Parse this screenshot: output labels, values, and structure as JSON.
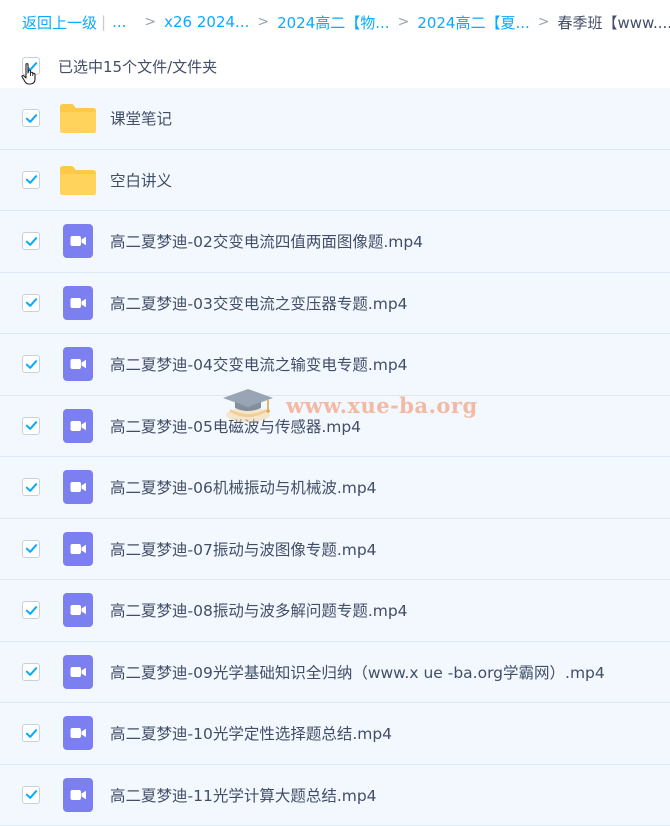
{
  "breadcrumb": {
    "back": "返回上一级",
    "ellipsis": "...",
    "items": [
      "x26 2024...",
      "2024高二【物...",
      "2024高二【夏...",
      "春季班【www...."
    ]
  },
  "selection": {
    "count_label": "已选中15个文件/文件夹"
  },
  "files": [
    {
      "name": "课堂笔记",
      "type": "folder"
    },
    {
      "name": "空白讲义",
      "type": "folder"
    },
    {
      "name": "高二夏梦迪-02交变电流四值两面图像题.mp4",
      "type": "video"
    },
    {
      "name": "高二夏梦迪-03交变电流之变压器专题.mp4",
      "type": "video"
    },
    {
      "name": "高二夏梦迪-04交变电流之输变电专题.mp4",
      "type": "video"
    },
    {
      "name": "高二夏梦迪-05电磁波与传感器.mp4",
      "type": "video"
    },
    {
      "name": "高二夏梦迪-06机械振动与机械波.mp4",
      "type": "video"
    },
    {
      "name": "高二夏梦迪-07振动与波图像专题.mp4",
      "type": "video"
    },
    {
      "name": "高二夏梦迪-08振动与波多解问题专题.mp4",
      "type": "video"
    },
    {
      "name": "高二夏梦迪-09光学基础知识全归纳（www.x ue -ba.org学霸网）.mp4",
      "type": "video"
    },
    {
      "name": "高二夏梦迪-10光学定性选择题总结.mp4",
      "type": "video"
    },
    {
      "name": "高二夏梦迪-11光学计算大题总结.mp4",
      "type": "video"
    }
  ],
  "watermark": {
    "text": "www.xue-ba.org"
  },
  "colors": {
    "accent": "#09aaff",
    "row_bg": "#f2f8fe",
    "folder": "#ffc948",
    "video": "#7b7ff0",
    "watermark": "#f3b9a2"
  },
  "icons": {
    "folder": "folder-icon",
    "video": "video-file-icon",
    "check": "checkmark-icon",
    "cursor": "hand-pointer-icon",
    "watermark_logo": "graduation-cap-icon"
  }
}
